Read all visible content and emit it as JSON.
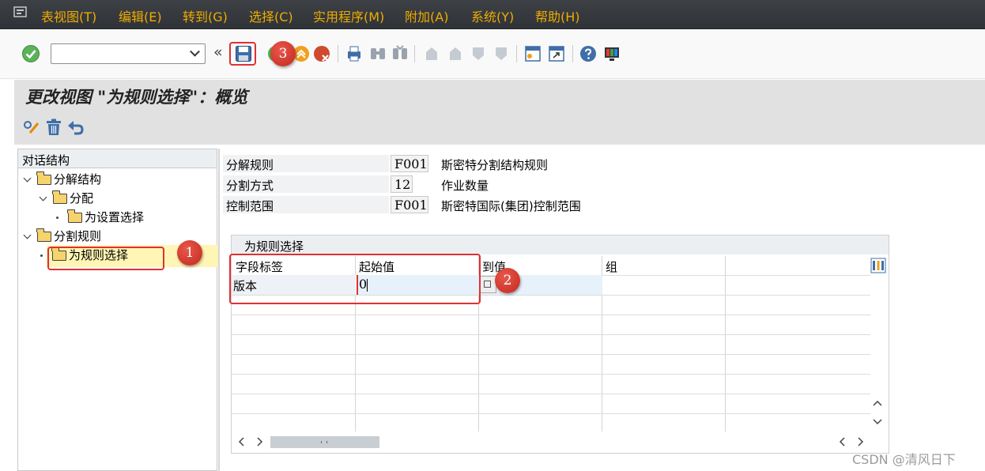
{
  "menu": [
    "表视图(T)",
    "编辑(E)",
    "转到(G)",
    "选择(C)",
    "实用程序(M)",
    "附加(A)",
    "系统(Y)",
    "帮助(H)"
  ],
  "toolbar": {
    "command_value": "",
    "collapse_glyph": "«"
  },
  "title": "更改视图 \"为规则选择\"：概览",
  "dialog_structure": {
    "header": "对话结构",
    "nodes": [
      {
        "label": "分解结构",
        "level": 0,
        "expanded": true
      },
      {
        "label": "分配",
        "level": 1,
        "expanded": true
      },
      {
        "label": "为设置选择",
        "level": 2
      },
      {
        "label": "分割规则",
        "level": 0,
        "expanded": true
      },
      {
        "label": "为规则选择",
        "level": 1,
        "selected": true
      }
    ]
  },
  "fields": [
    {
      "label": "分解规则",
      "value": "F001",
      "desc": "斯密特分割结构规则"
    },
    {
      "label": "分割方式",
      "value": "12",
      "desc": "作业数量"
    },
    {
      "label": "控制范围",
      "value": "F001",
      "desc": "斯密特国际(集团)控制范围"
    }
  ],
  "table": {
    "title": "为规则选择",
    "columns": [
      "字段标签",
      "起始值",
      "到值",
      "组"
    ],
    "rows": [
      {
        "field_label": "版本",
        "from_value": "0",
        "to_value": "",
        "group": ""
      }
    ]
  },
  "badges": [
    "1",
    "2",
    "3"
  ],
  "colors": {
    "menu_text": "#f0ab00",
    "selection": "#fff5b4",
    "highlight": "#e03030"
  },
  "watermark": "CSDN @清风日下"
}
